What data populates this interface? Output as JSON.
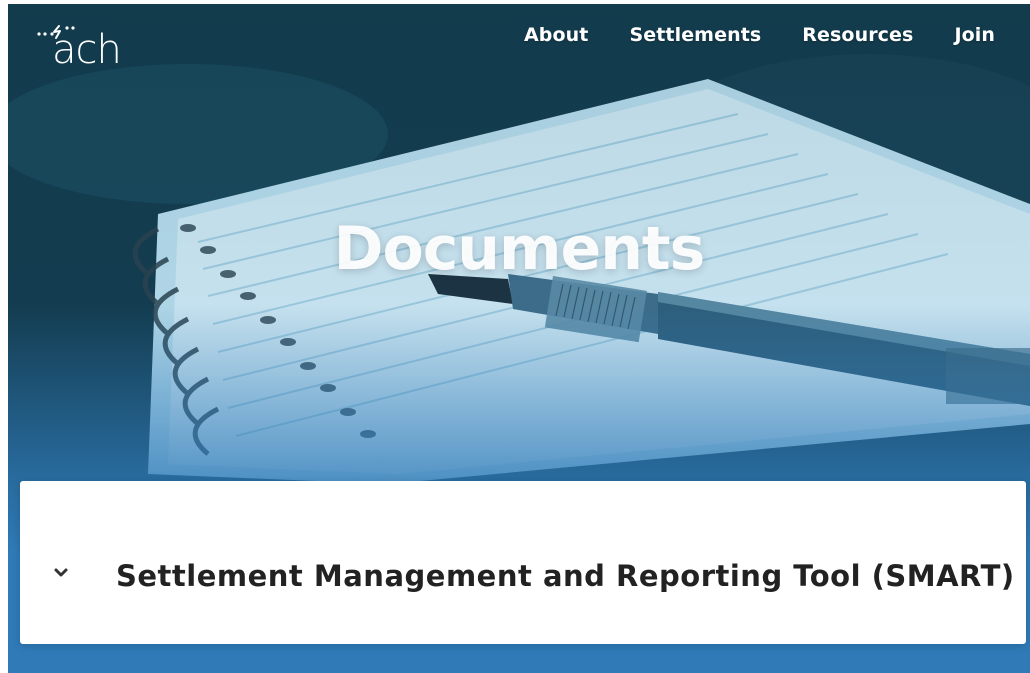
{
  "brand": {
    "logo_text": "ach"
  },
  "nav": {
    "items": [
      {
        "label": "About"
      },
      {
        "label": "Settlements"
      },
      {
        "label": "Resources"
      },
      {
        "label": "Join"
      }
    ]
  },
  "hero": {
    "title": "Documents"
  },
  "accordion": {
    "items": [
      {
        "title": "Settlement Management and Reporting Tool (SMART)",
        "expanded": false
      }
    ]
  },
  "colors": {
    "primary_blue": "#2f7ab7",
    "card_bg": "#ffffff",
    "text_dark": "#222222",
    "nav_text": "#ffffff"
  },
  "icons": [
    "logo-mark-icon",
    "chevron-down-icon"
  ]
}
